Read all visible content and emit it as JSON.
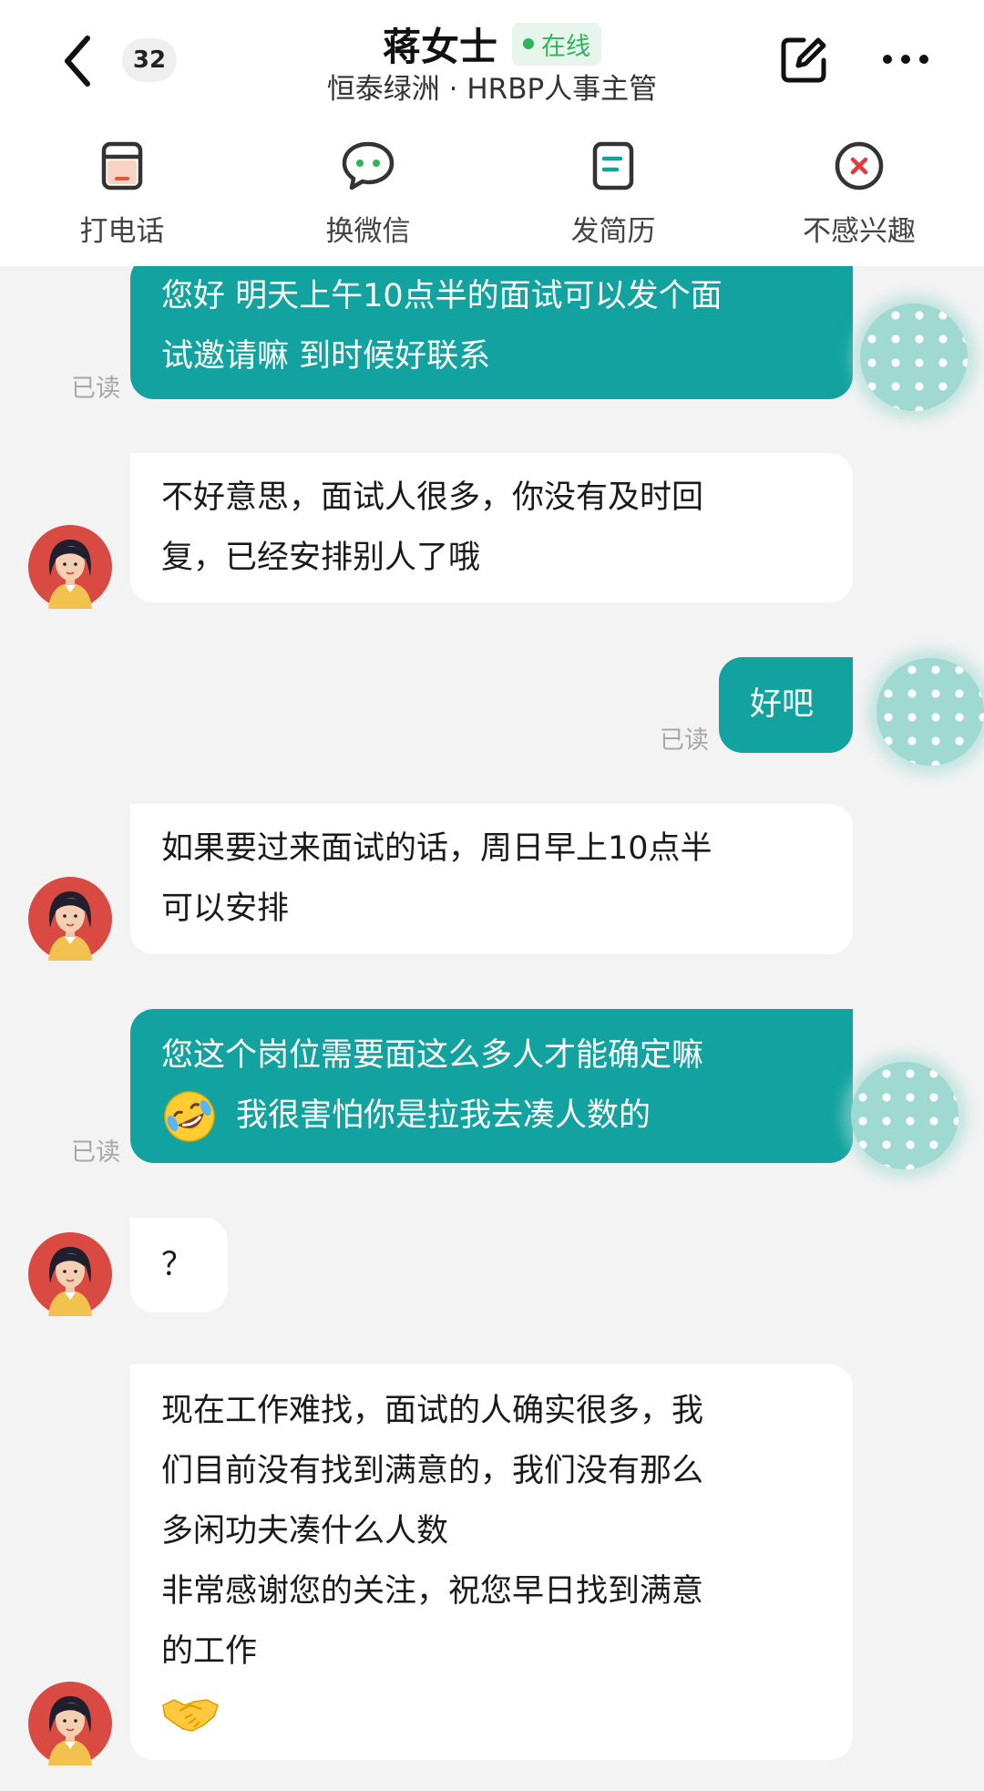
{
  "header": {
    "unread_count": "32",
    "contact_name": "蒋女士",
    "status": "在线",
    "subtitle": "恒泰绿洲 · HRBP人事主管"
  },
  "actions": [
    {
      "label": "打电话",
      "icon": "phone-icon",
      "color": "#e8553d"
    },
    {
      "label": "换微信",
      "icon": "wechat-icon",
      "color": "#2fb457"
    },
    {
      "label": "发简历",
      "icon": "resume-icon",
      "color": "#12a3a0"
    },
    {
      "label": "不感兴趣",
      "icon": "not-interested-icon",
      "color": "#e23b3b"
    }
  ],
  "messages": [
    {
      "from": "me",
      "lines": [
        "您好  明天上午10点半的面试可以发个面",
        "试邀请嘛 到时候好联系"
      ],
      "read": "已读"
    },
    {
      "from": "her",
      "lines": [
        "不好意思，面试人很多，你没有及时回",
        "复，已经安排别人了哦"
      ]
    },
    {
      "from": "me",
      "lines": [
        "好吧"
      ],
      "read": "已读"
    },
    {
      "from": "her",
      "lines": [
        "如果要过来面试的话，周日早上10点半",
        "可以安排"
      ]
    },
    {
      "from": "me",
      "lines": [
        "您这个岗位需要面这么多人才能确定嘛",
        "我很害怕你是拉我去凑人数的"
      ],
      "emoji": "laughing-crying-emoji",
      "read": "已读"
    },
    {
      "from": "her",
      "lines": [
        "？"
      ]
    },
    {
      "from": "her",
      "lines": [
        "现在工作难找，面试的人确实很多，我",
        "们目前没有找到满意的，我们没有那么",
        "多闲功夫凑什么人数",
        "非常感谢您的关注，祝您早日找到满意",
        "的工作"
      ],
      "emoji": "handshake-emoji"
    }
  ],
  "colors": {
    "accent": "#12a3a0",
    "background": "#f3f3f3",
    "online": "#2fb457"
  }
}
